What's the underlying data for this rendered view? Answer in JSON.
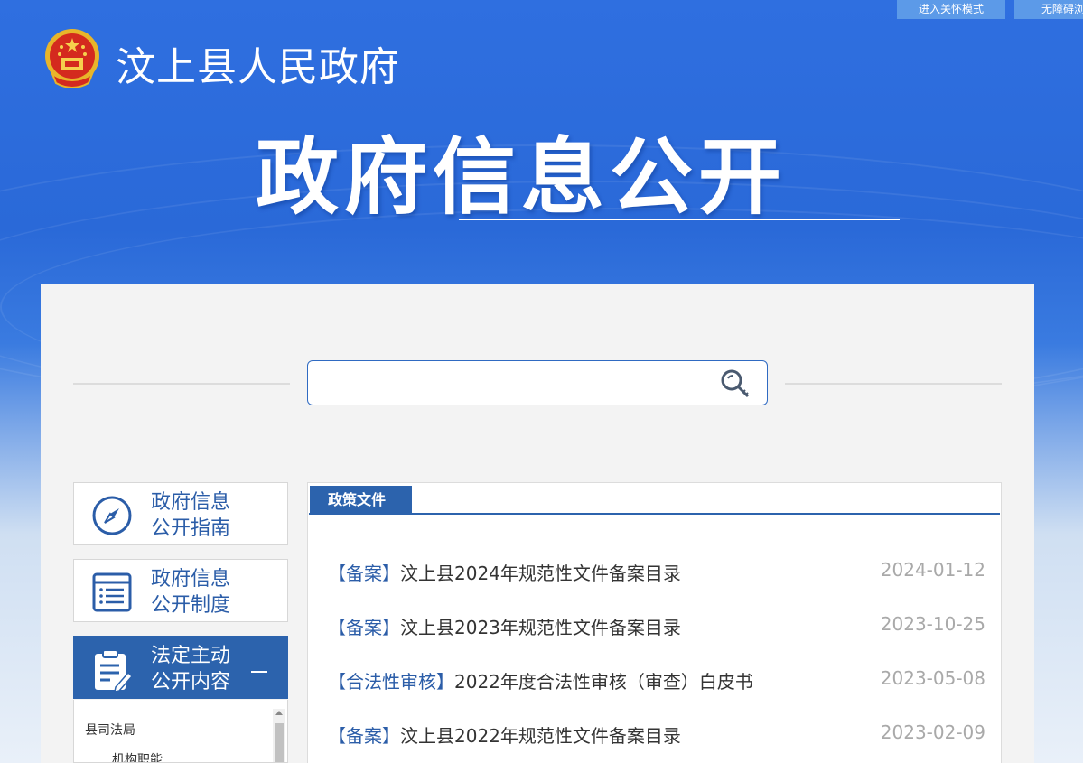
{
  "top_buttons": {
    "care_mode": "进入关怀模式",
    "accessible": "无障碍浏"
  },
  "header": {
    "site_title": "汶上县人民政府",
    "banner_title": "政府信息公开"
  },
  "search": {
    "placeholder": ""
  },
  "left_nav": {
    "items": [
      {
        "label": "政府信息\n公开指南",
        "icon": "compass-icon"
      },
      {
        "label": "政府信息\n公开制度",
        "icon": "document-list-icon"
      },
      {
        "label": "法定主动\n公开内容",
        "icon": "clipboard-edit-icon"
      }
    ],
    "sub_items": [
      "县司法局",
      "机构职能"
    ]
  },
  "list": {
    "tab_label": "政策文件",
    "rows": [
      {
        "category": "【备案】",
        "title": "汶上县2024年规范性文件备案目录",
        "date": "2024-01-12"
      },
      {
        "category": "【备案】",
        "title": "汶上县2023年规范性文件备案目录",
        "date": "2023-10-25"
      },
      {
        "category": "【合法性审核】",
        "title": "2022年度合法性审核（审查）白皮书",
        "date": "2023-05-08"
      },
      {
        "category": "【备案】",
        "title": "汶上县2022年规范性文件备案目录",
        "date": "2023-02-09"
      }
    ]
  },
  "colors": {
    "primary_blue": "#2c63ad",
    "link_blue": "#2b5da8",
    "date_gray": "#a9a9a9",
    "banner_blue": "#2f6fe0"
  }
}
